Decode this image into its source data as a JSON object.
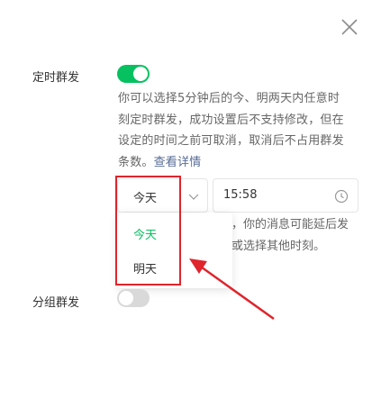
{
  "dialog": {
    "close_icon": "close-icon"
  },
  "scheduled_send": {
    "label": "定时群发",
    "enabled": true,
    "description_lines": [
      "你可以选择5分钟后的今、明两天内任意时",
      "刻定时群发，成功设置后不支持修改，但在",
      "设定的时间之前可取消，取消后不占用群发",
      "条数。"
    ],
    "details_link": "查看详情",
    "day_select": {
      "value": "今天",
      "options": [
        "今天",
        "明天"
      ],
      "selected_option": "今天"
    },
    "time_select": {
      "value": "15:58"
    },
    "hint_line1": "，你的消息可能延后发",
    "hint_line2": "或选择其他时刻。"
  },
  "group_send": {
    "label": "分组群发",
    "enabled": false
  },
  "colors": {
    "accent_green": "#07c160",
    "link": "#576b95",
    "annotation_red": "#e0242b"
  }
}
